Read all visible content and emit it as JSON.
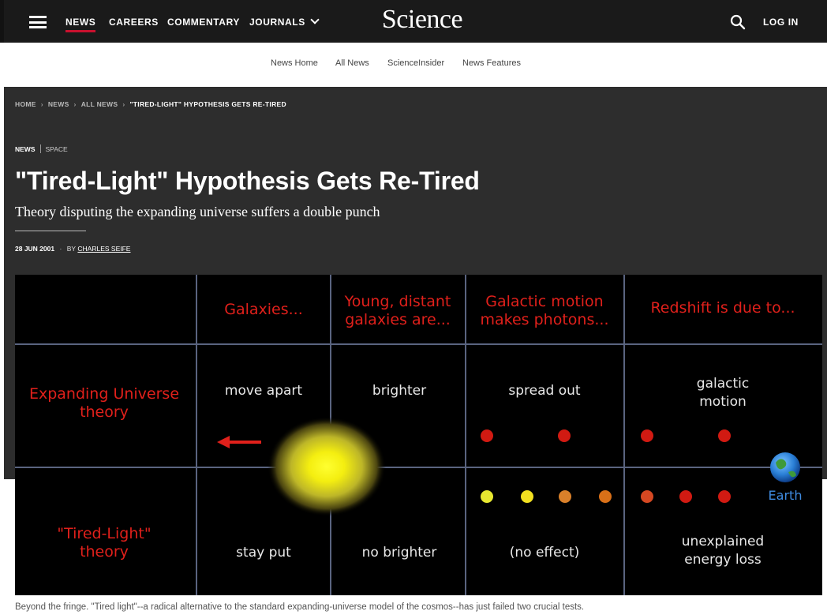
{
  "header": {
    "nav": [
      "NEWS",
      "CAREERS",
      "COMMENTARY",
      "JOURNALS"
    ],
    "logo": "Science",
    "login": "LOG IN"
  },
  "subnav": [
    "News Home",
    "All News",
    "ScienceInsider",
    "News Features"
  ],
  "breadcrumb": [
    "HOME",
    "NEWS",
    "ALL NEWS",
    "\"TIRED-LIGHT\" HYPOTHESIS GETS RE-TIRED"
  ],
  "article": {
    "category": "NEWS",
    "subcategory": "SPACE",
    "title": "\"Tired-Light\" Hypothesis Gets Re-Tired",
    "dek": "Theory disputing the expanding universe suffers a double punch",
    "date": "28 JUN 2001",
    "by": "BY",
    "author": "CHARLES SEIFE"
  },
  "figure": {
    "headers": [
      "Galaxies...",
      "Young, distant",
      "galaxies are...",
      "Galactic motion",
      "makes photons...",
      "Redshift is due to..."
    ],
    "row1_label": [
      "Expanding Universe",
      "theory"
    ],
    "row1": [
      "move apart",
      "brighter",
      "spread out",
      "galactic",
      "motion"
    ],
    "row2_label": [
      "\"Tired-Light\"",
      "theory"
    ],
    "row2": [
      "stay put",
      "no brighter",
      "(no effect)",
      "unexplained",
      "energy loss"
    ],
    "earth": "Earth",
    "colors": {
      "red_text": "#e0201b",
      "white_text": "#e8e8e8",
      "grid": "#5a6480"
    }
  },
  "caption": "Beyond the fringe. \"Tired light\"--a radical alternative to the standard expanding-universe model of the cosmos--has just failed two crucial tests."
}
